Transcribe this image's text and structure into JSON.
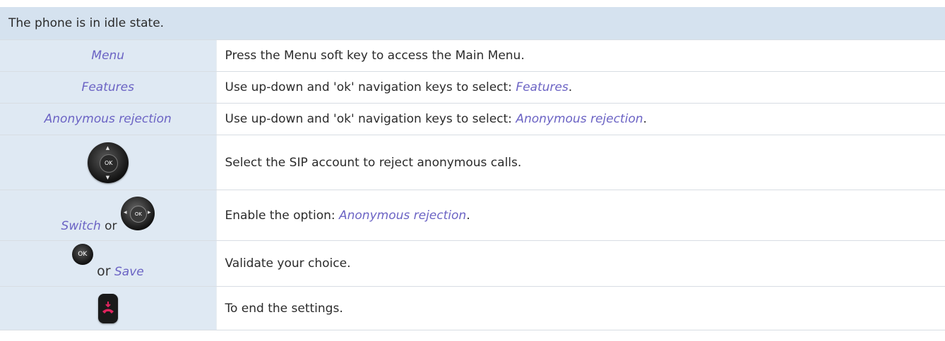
{
  "header": {
    "text": "The phone is in idle state."
  },
  "rows": [
    {
      "key": "Menu",
      "desc": "Press the Menu soft key to access the Main Menu."
    },
    {
      "key": "Features",
      "desc_prefix": "Use up-down and 'ok' navigation keys to select: ",
      "desc_kw": "Features",
      "desc_suffix": "."
    },
    {
      "key": "Anonymous rejection",
      "desc_prefix": "Use up-down and 'ok' navigation keys to select: ",
      "desc_kw": "Anonymous rejection",
      "desc_suffix": "."
    },
    {
      "icon": "ok-navigation-pad-icon",
      "desc": "Select the SIP account to reject anonymous calls."
    },
    {
      "key": "Switch",
      "or": "or",
      "icon": "left-right-navigation-pad-icon",
      "desc_prefix": "Enable the option: ",
      "desc_kw": "Anonymous rejection",
      "desc_suffix": "."
    },
    {
      "icon": "ok-button-icon",
      "or": "or",
      "key": "Save",
      "desc": "Validate your choice."
    },
    {
      "icon": "end-call-key-icon",
      "desc": "To end the settings."
    }
  ],
  "ok_label": "OK",
  "colors": {
    "header_bg": "#d5e2ef",
    "key_cell_bg": "#dfe9f3",
    "keyword": "#6b63c4",
    "end_call": "#e0245e"
  }
}
